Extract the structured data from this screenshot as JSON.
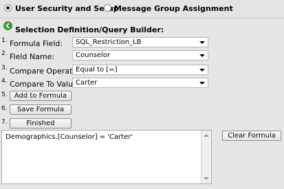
{
  "tabs": [
    {
      "label": "User Security and Setup",
      "selected": true
    },
    {
      "label": "Message Group Assignment",
      "selected": false
    }
  ],
  "section": {
    "title": "Selection Definition/Query Builder:"
  },
  "fields": [
    {
      "num": "1.",
      "label": "Formula Field:",
      "value": "SQL_Restriction_LB"
    },
    {
      "num": "2.",
      "label": "Field Name:",
      "value": "Counselor"
    },
    {
      "num": "3.",
      "label": "Compare Operation:",
      "value": "Equal to [=]"
    },
    {
      "num": "4.",
      "label": "Compare To Value:",
      "value": "Carter"
    }
  ],
  "actions": [
    {
      "num": "5.",
      "label": "Add to Formula"
    },
    {
      "num": "6.",
      "label": "Save Formula"
    },
    {
      "num": "7.",
      "label": "Finished"
    }
  ],
  "formula": {
    "text": "Demographics.[Counselor] = 'Carter'"
  },
  "clear_label": "Clear Formula",
  "colors": {
    "back_icon": "#3a9a2e"
  }
}
